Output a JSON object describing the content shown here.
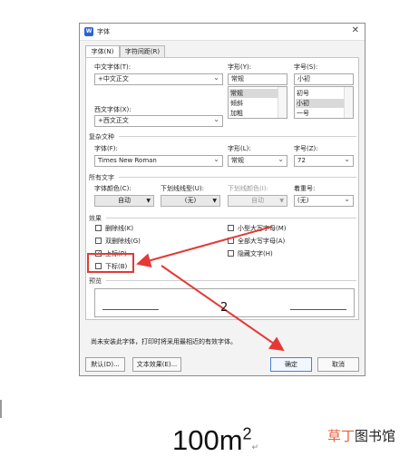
{
  "dialog": {
    "title": "字体",
    "app_icon": "W",
    "close_glyph": "✕",
    "tabs": [
      {
        "label": "字体(N)"
      },
      {
        "label": "字符间距(R)"
      }
    ],
    "chinese_font": {
      "label": "中文字体(T):",
      "value": "+中文正文"
    },
    "western_font": {
      "label": "西文字体(X):",
      "value": "+西文正文"
    },
    "style": {
      "label": "字形(Y):",
      "value": "常规",
      "options": [
        "常规",
        "倾斜",
        "加粗"
      ]
    },
    "size": {
      "label": "字号(S):",
      "value": "小初",
      "options": [
        "初号",
        "小初",
        "一号"
      ]
    },
    "complex_section": "复杂文种",
    "complex_font": {
      "label": "字体(F):",
      "value": "Times New Roman"
    },
    "complex_style": {
      "label": "字形(L):",
      "value": "常规"
    },
    "complex_size": {
      "label": "字号(Z):",
      "value": "72"
    },
    "all_text_section": "所有文字",
    "font_color": {
      "label": "字体颜色(C):",
      "value": "自动"
    },
    "underline_type": {
      "label": "下划线线型(U):",
      "value": "(无)"
    },
    "underline_color": {
      "label": "下划线颜色(I):",
      "value": "自动"
    },
    "emphasis": {
      "label": "着重号:",
      "value": "(无)"
    },
    "effects_section": "效果",
    "effects_left": [
      {
        "label": "删除线(K)",
        "checked": false
      },
      {
        "label": "双删除线(G)",
        "checked": false
      },
      {
        "label": "上标(P)",
        "checked": true
      },
      {
        "label": "下标(B)",
        "checked": false
      }
    ],
    "effects_right": [
      {
        "label": "小型大写字母(M)",
        "checked": false
      },
      {
        "label": "全部大写字母(A)",
        "checked": false
      },
      {
        "label": "隐藏文字(H)",
        "checked": false
      }
    ],
    "preview_section": "预览",
    "footnote": "尚未安装此字体，打印时将采用最相近的有效字体。",
    "buttons": {
      "default": "默认(D)...",
      "text_effect": "文本效果(E)...",
      "ok": "确定",
      "cancel": "取消"
    }
  },
  "annotation": {
    "number": "2",
    "color": "#e53935"
  },
  "caption": {
    "base": "100m",
    "sup": "2",
    "mark": "↵"
  },
  "watermark": {
    "part1": "草丁",
    "part2": "图书馆"
  }
}
